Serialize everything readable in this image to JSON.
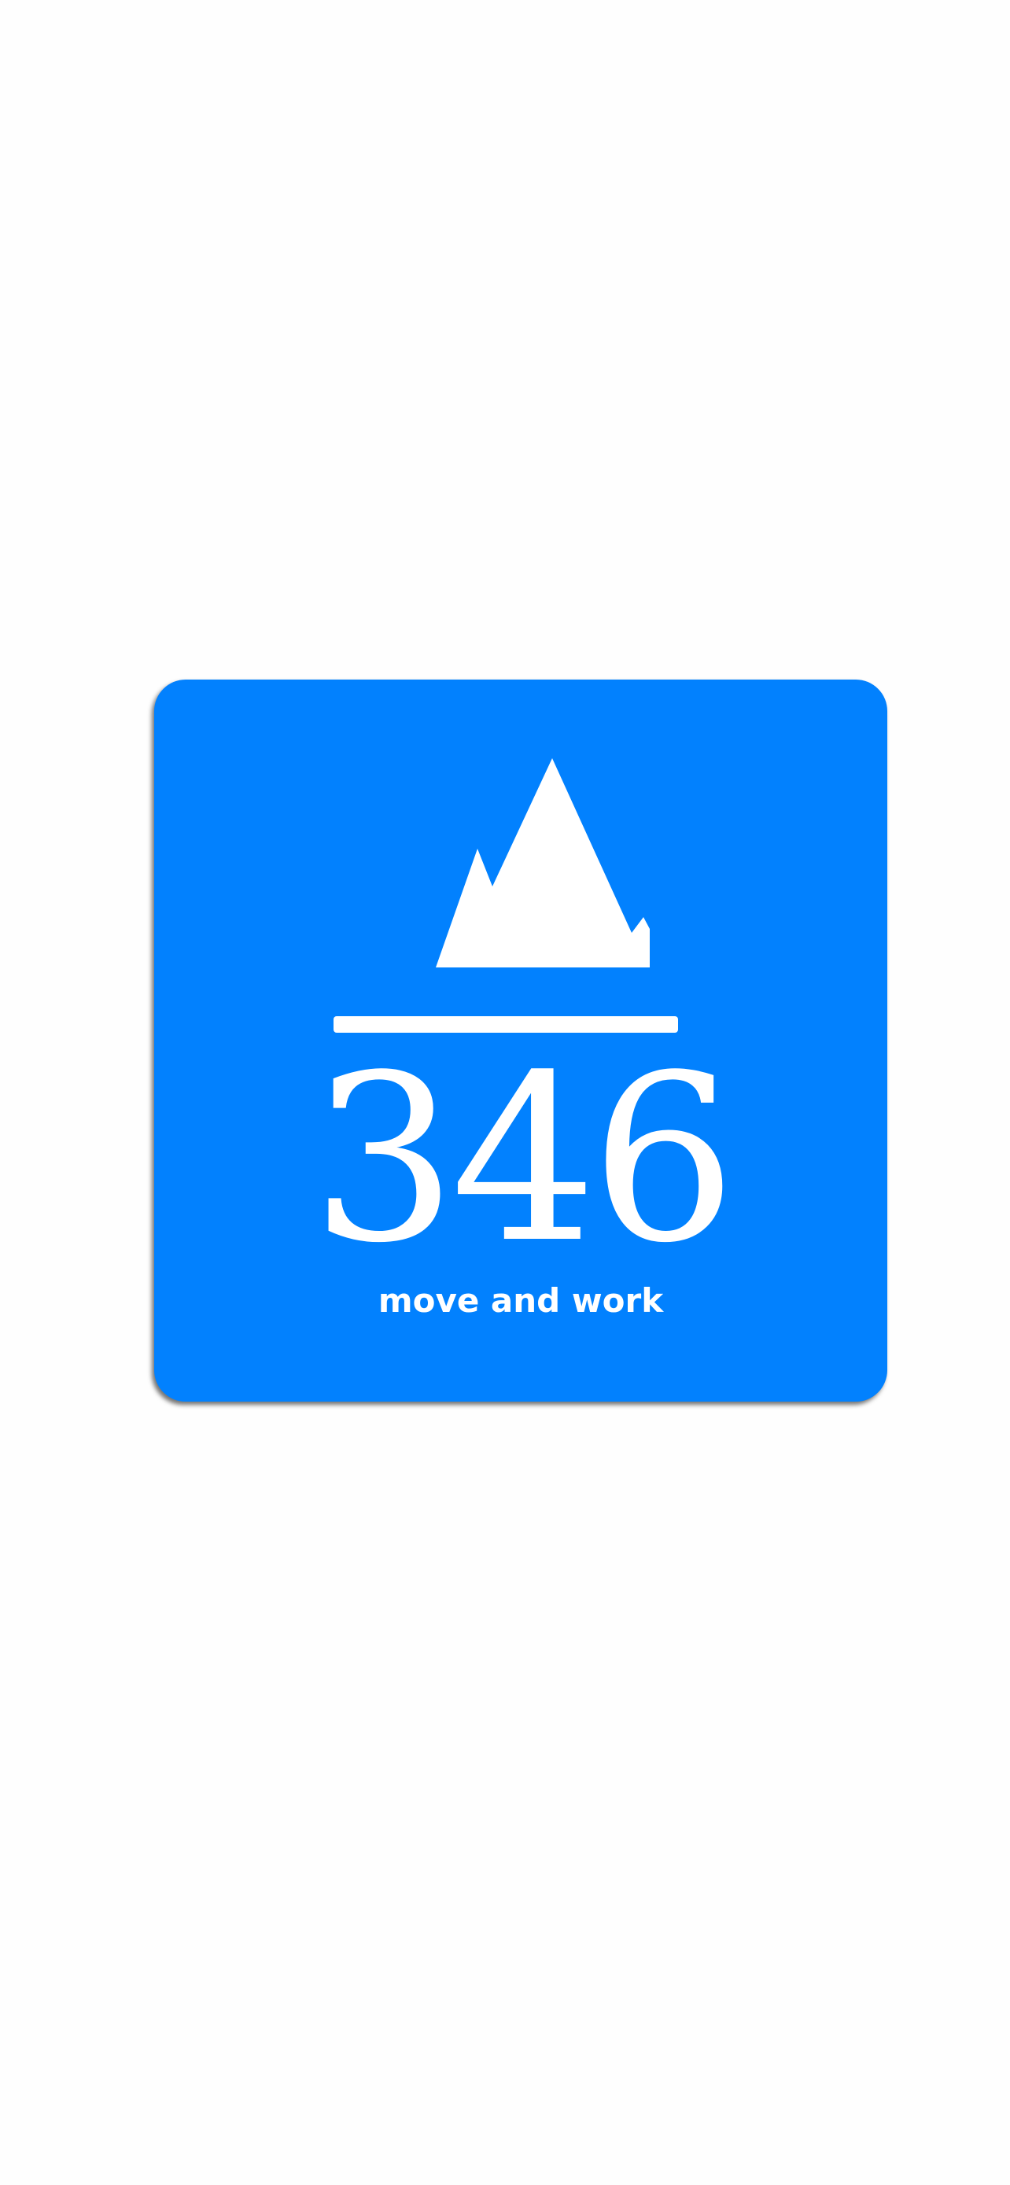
{
  "splash": {
    "logo": {
      "number": "346",
      "tagline": "move and work",
      "icon": "mountain-icon",
      "background_color": "#0281fe",
      "foreground_color": "#ffffff"
    },
    "page_background": "#fefefe"
  }
}
